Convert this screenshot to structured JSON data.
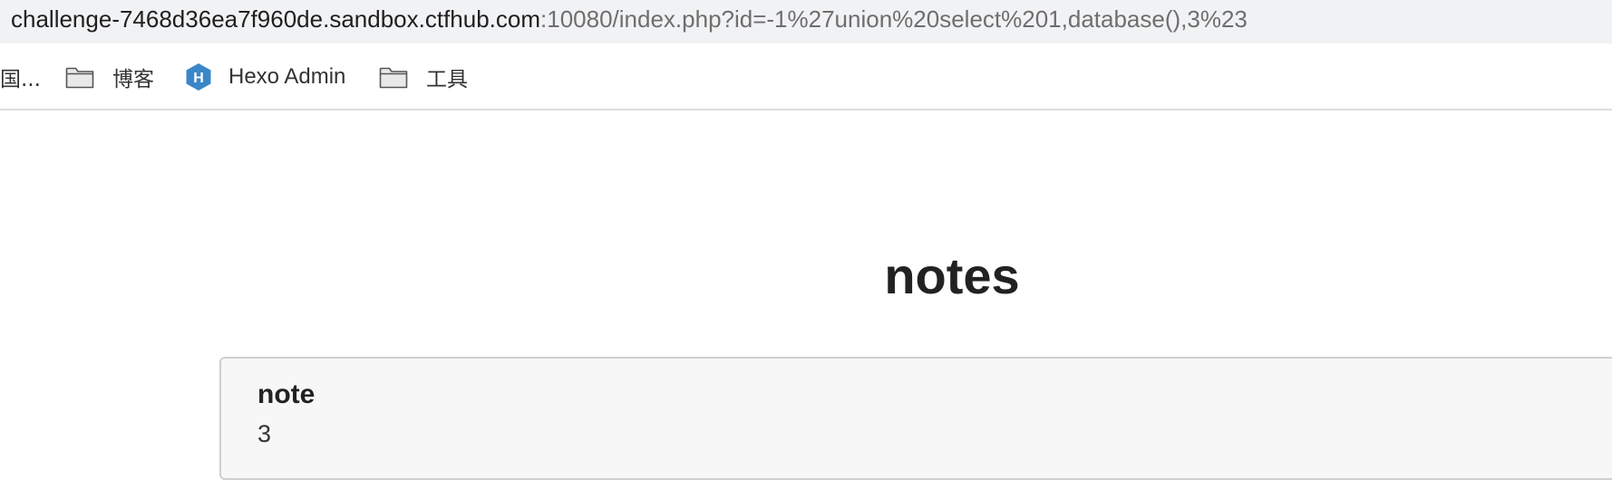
{
  "address_bar": {
    "host": "challenge-7468d36ea7f960de.sandbox.ctfhub.com",
    "path": ":10080/index.php?id=-1%27union%20select%201,database(),3%23"
  },
  "bookmarks": [
    {
      "label": "国...",
      "icon": "truncated-bookmark"
    },
    {
      "label": "博客",
      "icon": "folder-icon"
    },
    {
      "label": "Hexo Admin",
      "icon": "hexo-icon"
    },
    {
      "label": "工具",
      "icon": "folder-icon"
    }
  ],
  "page": {
    "title": "notes",
    "card": {
      "title": "note",
      "value": "3"
    }
  },
  "colors": {
    "address_bar_bg": "#f1f2f4",
    "hexo_brand": "#3b86c9",
    "card_bg": "#f7f7f7"
  }
}
